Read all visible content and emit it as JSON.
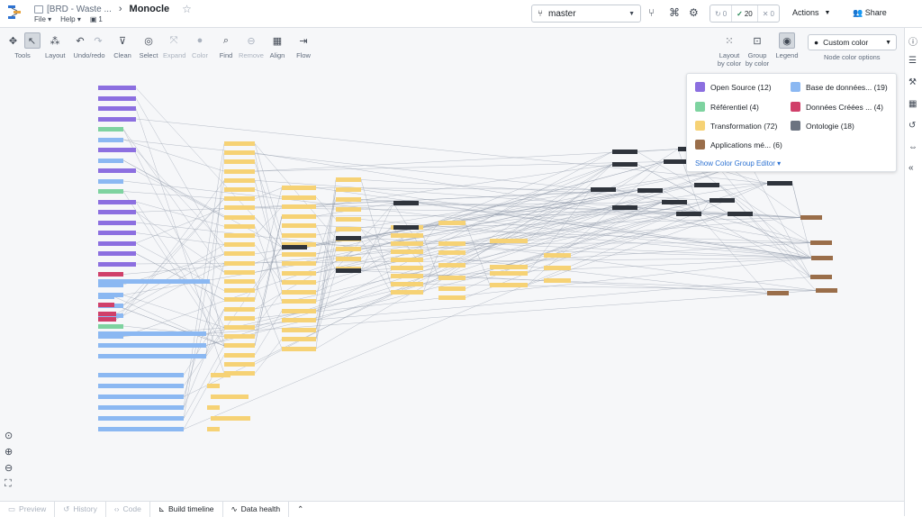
{
  "header": {
    "breadcrumb_parent": "[BRD - Waste ...",
    "title": "Monocle",
    "menu_file": "File",
    "menu_help": "Help",
    "resource_count": "1",
    "branch": "master",
    "checks_pending": "0",
    "checks_passed": "20",
    "checks_failed": "0",
    "actions_label": "Actions",
    "share_label": "Share"
  },
  "toolbar": {
    "tools": "Tools",
    "layout": "Layout",
    "undo_redo": "Undo/redo",
    "clean": "Clean",
    "select": "Select",
    "expand": "Expand",
    "color": "Color",
    "find": "Find",
    "remove": "Remove",
    "align": "Align",
    "flow": "Flow",
    "layout_by_color": "Layout by color",
    "group_by_color": "Group by color",
    "legend": "Legend",
    "custom_color": "Custom color",
    "node_color_options": "Node color options"
  },
  "legend": {
    "items": [
      {
        "label": "Open Source (12)",
        "color": "#8c6fe0"
      },
      {
        "label": "Base de données... (19)",
        "color": "#8bb8f2"
      },
      {
        "label": "Référentiel (4)",
        "color": "#7ed3a0"
      },
      {
        "label": "Données Créées ... (4)",
        "color": "#d0406a"
      },
      {
        "label": "Transformation (72)",
        "color": "#f6d275"
      },
      {
        "label": "Ontologie (18)",
        "color": "#6b7380"
      },
      {
        "label": "Applications mé... (6)",
        "color": "#9a6e4a"
      }
    ],
    "show_editor": "Show Color Group Editor"
  },
  "bottom_tabs": {
    "preview": "Preview",
    "history": "History",
    "code": "Code",
    "build_timeline": "Build timeline",
    "data_health": "Data health"
  }
}
